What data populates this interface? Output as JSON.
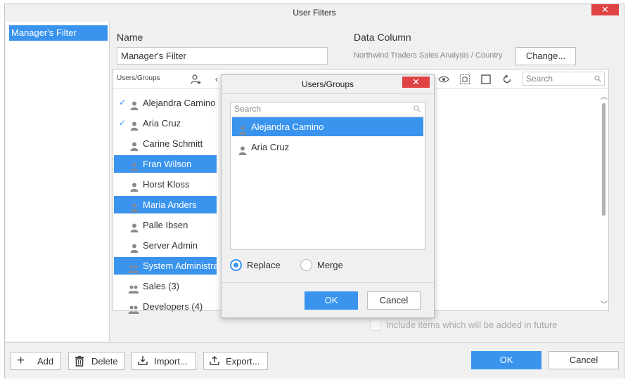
{
  "window": {
    "title": "User Filters",
    "close_glyph": "✕"
  },
  "sidebar": {
    "items": [
      {
        "label": "Manager's Filter"
      }
    ]
  },
  "form": {
    "name_label": "Name",
    "name_value": "Manager's Filter",
    "data_column_label": "Data Column",
    "data_column_value": "Northwind Traders Sales Analysis / Country",
    "change_button": "Change..."
  },
  "users_panel": {
    "header": "Users/Groups",
    "search_placeholder": "Search",
    "items": [
      {
        "label": "Alejandra Camino",
        "checked": true,
        "selected": false,
        "icon": "user-icon"
      },
      {
        "label": "Aria Cruz",
        "checked": true,
        "selected": false,
        "icon": "user-icon"
      },
      {
        "label": "Carine Schmitt",
        "checked": false,
        "selected": false,
        "icon": "user-icon"
      },
      {
        "label": "Fran Wilson",
        "checked": false,
        "selected": true,
        "icon": "user-icon"
      },
      {
        "label": "Horst Kloss",
        "checked": false,
        "selected": false,
        "icon": "user-icon"
      },
      {
        "label": "Maria Anders",
        "checked": false,
        "selected": true,
        "icon": "user-icon"
      },
      {
        "label": "Palle Ibsen",
        "checked": false,
        "selected": false,
        "icon": "user-icon"
      },
      {
        "label": "Server Admin",
        "checked": false,
        "selected": false,
        "icon": "user-icon"
      },
      {
        "label": "System Administra",
        "checked": false,
        "selected": true,
        "icon": "group-icon"
      },
      {
        "label": "Sales (3)",
        "checked": false,
        "selected": false,
        "icon": "group-icon"
      },
      {
        "label": "Developers (4)",
        "checked": false,
        "selected": false,
        "icon": "group-icon"
      }
    ],
    "include_future_label": "Include items which will be added in future"
  },
  "dialog": {
    "title": "Users/Groups",
    "close_glyph": "✕",
    "search_placeholder": "Search",
    "items": [
      {
        "label": "Alejandra Camino",
        "selected": true
      },
      {
        "label": "Aria Cruz",
        "selected": false
      }
    ],
    "replace_label": "Replace",
    "merge_label": "Merge",
    "ok_button": "OK",
    "cancel_button": "Cancel"
  },
  "footer": {
    "add_button": "Add",
    "delete_button": "Delete",
    "import_button": "Import...",
    "export_button": "Export...",
    "ok_button": "OK",
    "cancel_button": "Cancel"
  },
  "colors": {
    "accent": "#3a94ee",
    "close": "#e04343"
  }
}
